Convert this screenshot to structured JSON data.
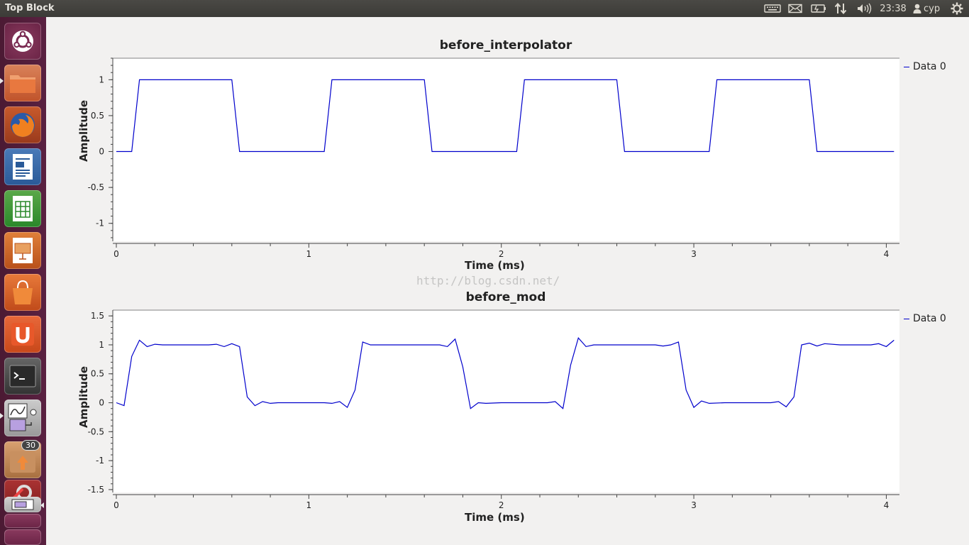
{
  "window": {
    "title": "Top Block"
  },
  "panel": {
    "clock": "23:38",
    "user": "cyp"
  },
  "launcher": {
    "items": [
      {
        "name": "dash-home-icon"
      },
      {
        "name": "files-icon"
      },
      {
        "name": "firefox-icon"
      },
      {
        "name": "writer-icon"
      },
      {
        "name": "calc-icon"
      },
      {
        "name": "impress-icon"
      },
      {
        "name": "software-center-icon"
      },
      {
        "name": "ubuntu-one-icon"
      },
      {
        "name": "terminal-icon"
      },
      {
        "name": "grc-icon"
      },
      {
        "name": "update-manager-icon"
      },
      {
        "name": "system-settings-icon"
      },
      {
        "name": "top-block-icon"
      },
      {
        "name": "workspace-icon"
      },
      {
        "name": "trash-icon"
      }
    ],
    "update_badge": "30"
  },
  "watermark": "http://blog.csdn.net/",
  "plots": [
    {
      "title": "before_interpolator",
      "xlabel": "Time (ms)",
      "ylabel": "Amplitude",
      "legend": "Data 0",
      "color": "#0000cc"
    },
    {
      "title": "before_mod",
      "xlabel": "Time (ms)",
      "ylabel": "Amplitude",
      "legend": "Data 0",
      "color": "#0000cc"
    }
  ],
  "chart_data": [
    {
      "type": "line",
      "title": "before_interpolator",
      "xlabel": "Time (ms)",
      "ylabel": "Amplitude",
      "xlim": [
        0,
        4.05
      ],
      "ylim": [
        -1.25,
        1.3
      ],
      "xticks": [
        "0",
        "1",
        "2",
        "3",
        "4"
      ],
      "yticks": [
        "1",
        "0.5",
        "0",
        "-0.5",
        "-1"
      ],
      "legend": "top-right",
      "series": [
        {
          "name": "Data 0",
          "x": [
            0,
            0.08,
            0.12,
            0.6,
            0.64,
            1.08,
            1.12,
            1.6,
            1.64,
            2.08,
            2.12,
            2.6,
            2.64,
            3.08,
            3.12,
            3.6,
            3.64,
            4.04
          ],
          "y": [
            0,
            0,
            1,
            1,
            0,
            0,
            1,
            1,
            0,
            0,
            1,
            1,
            0,
            0,
            1,
            1,
            0,
            0
          ]
        }
      ]
    },
    {
      "type": "line",
      "title": "before_mod",
      "xlabel": "Time (ms)",
      "ylabel": "Amplitude",
      "xlim": [
        0,
        4.05
      ],
      "ylim": [
        -1.55,
        1.6
      ],
      "xticks": [
        "0",
        "1",
        "2",
        "3",
        "4"
      ],
      "yticks": [
        "1.5",
        "1",
        "0.5",
        "0",
        "-0.5",
        "-1",
        "-1.5"
      ],
      "legend": "top-right",
      "series": [
        {
          "name": "Data 0",
          "x": [
            0,
            0.04,
            0.08,
            0.12,
            0.16,
            0.2,
            0.24,
            0.32,
            0.4,
            0.48,
            0.52,
            0.56,
            0.6,
            0.64,
            0.68,
            0.72,
            0.76,
            0.8,
            0.84,
            0.92,
            1.0,
            1.08,
            1.12,
            1.16,
            1.2,
            1.24,
            1.28,
            1.32,
            1.36,
            1.44,
            1.52,
            1.6,
            1.68,
            1.72,
            1.76,
            1.8,
            1.84,
            1.88,
            1.92,
            2.0,
            2.08,
            2.16,
            2.24,
            2.28,
            2.32,
            2.36,
            2.4,
            2.44,
            2.48,
            2.56,
            2.64,
            2.72,
            2.8,
            2.84,
            2.88,
            2.92,
            2.96,
            3.0,
            3.04,
            3.08,
            3.16,
            3.24,
            3.32,
            3.4,
            3.44,
            3.48,
            3.52,
            3.56,
            3.6,
            3.64,
            3.68,
            3.76,
            3.84,
            3.92,
            3.96,
            4.0,
            4.04
          ],
          "y": [
            0,
            -0.05,
            0.8,
            1.08,
            0.97,
            1.01,
            1.0,
            1.0,
            1.0,
            1.0,
            1.01,
            0.97,
            1.02,
            0.97,
            0.1,
            -0.05,
            0.02,
            -0.01,
            0.0,
            0.0,
            0.0,
            0.0,
            -0.01,
            0.02,
            -0.08,
            0.22,
            1.05,
            1.0,
            1.0,
            1.0,
            1.0,
            1.0,
            1.0,
            0.97,
            1.1,
            0.62,
            -0.1,
            0.0,
            -0.01,
            0.0,
            0.0,
            0.0,
            0.0,
            0.02,
            -0.1,
            0.65,
            1.12,
            0.97,
            1.0,
            1.0,
            1.0,
            1.0,
            1.0,
            0.98,
            1.0,
            1.05,
            0.22,
            -0.08,
            0.03,
            -0.01,
            0.0,
            0.0,
            0.0,
            0.0,
            0.02,
            -0.07,
            0.1,
            1.0,
            1.03,
            0.98,
            1.02,
            1.0,
            1.0,
            1.0,
            1.02,
            0.97,
            1.08
          ]
        }
      ]
    }
  ]
}
